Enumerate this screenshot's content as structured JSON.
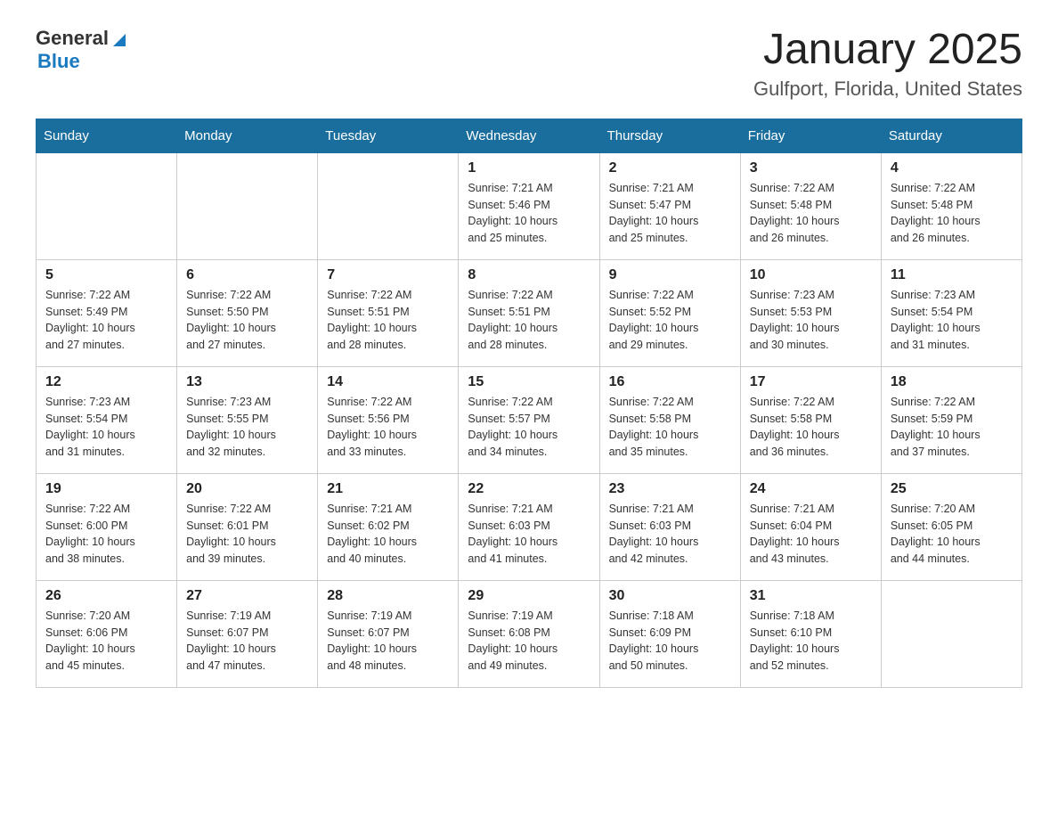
{
  "logo": {
    "general": "General",
    "blue": "Blue"
  },
  "header": {
    "month": "January 2025",
    "location": "Gulfport, Florida, United States"
  },
  "weekdays": [
    "Sunday",
    "Monday",
    "Tuesday",
    "Wednesday",
    "Thursday",
    "Friday",
    "Saturday"
  ],
  "weeks": [
    [
      {
        "day": "",
        "info": ""
      },
      {
        "day": "",
        "info": ""
      },
      {
        "day": "",
        "info": ""
      },
      {
        "day": "1",
        "info": "Sunrise: 7:21 AM\nSunset: 5:46 PM\nDaylight: 10 hours\nand 25 minutes."
      },
      {
        "day": "2",
        "info": "Sunrise: 7:21 AM\nSunset: 5:47 PM\nDaylight: 10 hours\nand 25 minutes."
      },
      {
        "day": "3",
        "info": "Sunrise: 7:22 AM\nSunset: 5:48 PM\nDaylight: 10 hours\nand 26 minutes."
      },
      {
        "day": "4",
        "info": "Sunrise: 7:22 AM\nSunset: 5:48 PM\nDaylight: 10 hours\nand 26 minutes."
      }
    ],
    [
      {
        "day": "5",
        "info": "Sunrise: 7:22 AM\nSunset: 5:49 PM\nDaylight: 10 hours\nand 27 minutes."
      },
      {
        "day": "6",
        "info": "Sunrise: 7:22 AM\nSunset: 5:50 PM\nDaylight: 10 hours\nand 27 minutes."
      },
      {
        "day": "7",
        "info": "Sunrise: 7:22 AM\nSunset: 5:51 PM\nDaylight: 10 hours\nand 28 minutes."
      },
      {
        "day": "8",
        "info": "Sunrise: 7:22 AM\nSunset: 5:51 PM\nDaylight: 10 hours\nand 28 minutes."
      },
      {
        "day": "9",
        "info": "Sunrise: 7:22 AM\nSunset: 5:52 PM\nDaylight: 10 hours\nand 29 minutes."
      },
      {
        "day": "10",
        "info": "Sunrise: 7:23 AM\nSunset: 5:53 PM\nDaylight: 10 hours\nand 30 minutes."
      },
      {
        "day": "11",
        "info": "Sunrise: 7:23 AM\nSunset: 5:54 PM\nDaylight: 10 hours\nand 31 minutes."
      }
    ],
    [
      {
        "day": "12",
        "info": "Sunrise: 7:23 AM\nSunset: 5:54 PM\nDaylight: 10 hours\nand 31 minutes."
      },
      {
        "day": "13",
        "info": "Sunrise: 7:23 AM\nSunset: 5:55 PM\nDaylight: 10 hours\nand 32 minutes."
      },
      {
        "day": "14",
        "info": "Sunrise: 7:22 AM\nSunset: 5:56 PM\nDaylight: 10 hours\nand 33 minutes."
      },
      {
        "day": "15",
        "info": "Sunrise: 7:22 AM\nSunset: 5:57 PM\nDaylight: 10 hours\nand 34 minutes."
      },
      {
        "day": "16",
        "info": "Sunrise: 7:22 AM\nSunset: 5:58 PM\nDaylight: 10 hours\nand 35 minutes."
      },
      {
        "day": "17",
        "info": "Sunrise: 7:22 AM\nSunset: 5:58 PM\nDaylight: 10 hours\nand 36 minutes."
      },
      {
        "day": "18",
        "info": "Sunrise: 7:22 AM\nSunset: 5:59 PM\nDaylight: 10 hours\nand 37 minutes."
      }
    ],
    [
      {
        "day": "19",
        "info": "Sunrise: 7:22 AM\nSunset: 6:00 PM\nDaylight: 10 hours\nand 38 minutes."
      },
      {
        "day": "20",
        "info": "Sunrise: 7:22 AM\nSunset: 6:01 PM\nDaylight: 10 hours\nand 39 minutes."
      },
      {
        "day": "21",
        "info": "Sunrise: 7:21 AM\nSunset: 6:02 PM\nDaylight: 10 hours\nand 40 minutes."
      },
      {
        "day": "22",
        "info": "Sunrise: 7:21 AM\nSunset: 6:03 PM\nDaylight: 10 hours\nand 41 minutes."
      },
      {
        "day": "23",
        "info": "Sunrise: 7:21 AM\nSunset: 6:03 PM\nDaylight: 10 hours\nand 42 minutes."
      },
      {
        "day": "24",
        "info": "Sunrise: 7:21 AM\nSunset: 6:04 PM\nDaylight: 10 hours\nand 43 minutes."
      },
      {
        "day": "25",
        "info": "Sunrise: 7:20 AM\nSunset: 6:05 PM\nDaylight: 10 hours\nand 44 minutes."
      }
    ],
    [
      {
        "day": "26",
        "info": "Sunrise: 7:20 AM\nSunset: 6:06 PM\nDaylight: 10 hours\nand 45 minutes."
      },
      {
        "day": "27",
        "info": "Sunrise: 7:19 AM\nSunset: 6:07 PM\nDaylight: 10 hours\nand 47 minutes."
      },
      {
        "day": "28",
        "info": "Sunrise: 7:19 AM\nSunset: 6:07 PM\nDaylight: 10 hours\nand 48 minutes."
      },
      {
        "day": "29",
        "info": "Sunrise: 7:19 AM\nSunset: 6:08 PM\nDaylight: 10 hours\nand 49 minutes."
      },
      {
        "day": "30",
        "info": "Sunrise: 7:18 AM\nSunset: 6:09 PM\nDaylight: 10 hours\nand 50 minutes."
      },
      {
        "day": "31",
        "info": "Sunrise: 7:18 AM\nSunset: 6:10 PM\nDaylight: 10 hours\nand 52 minutes."
      },
      {
        "day": "",
        "info": ""
      }
    ]
  ]
}
